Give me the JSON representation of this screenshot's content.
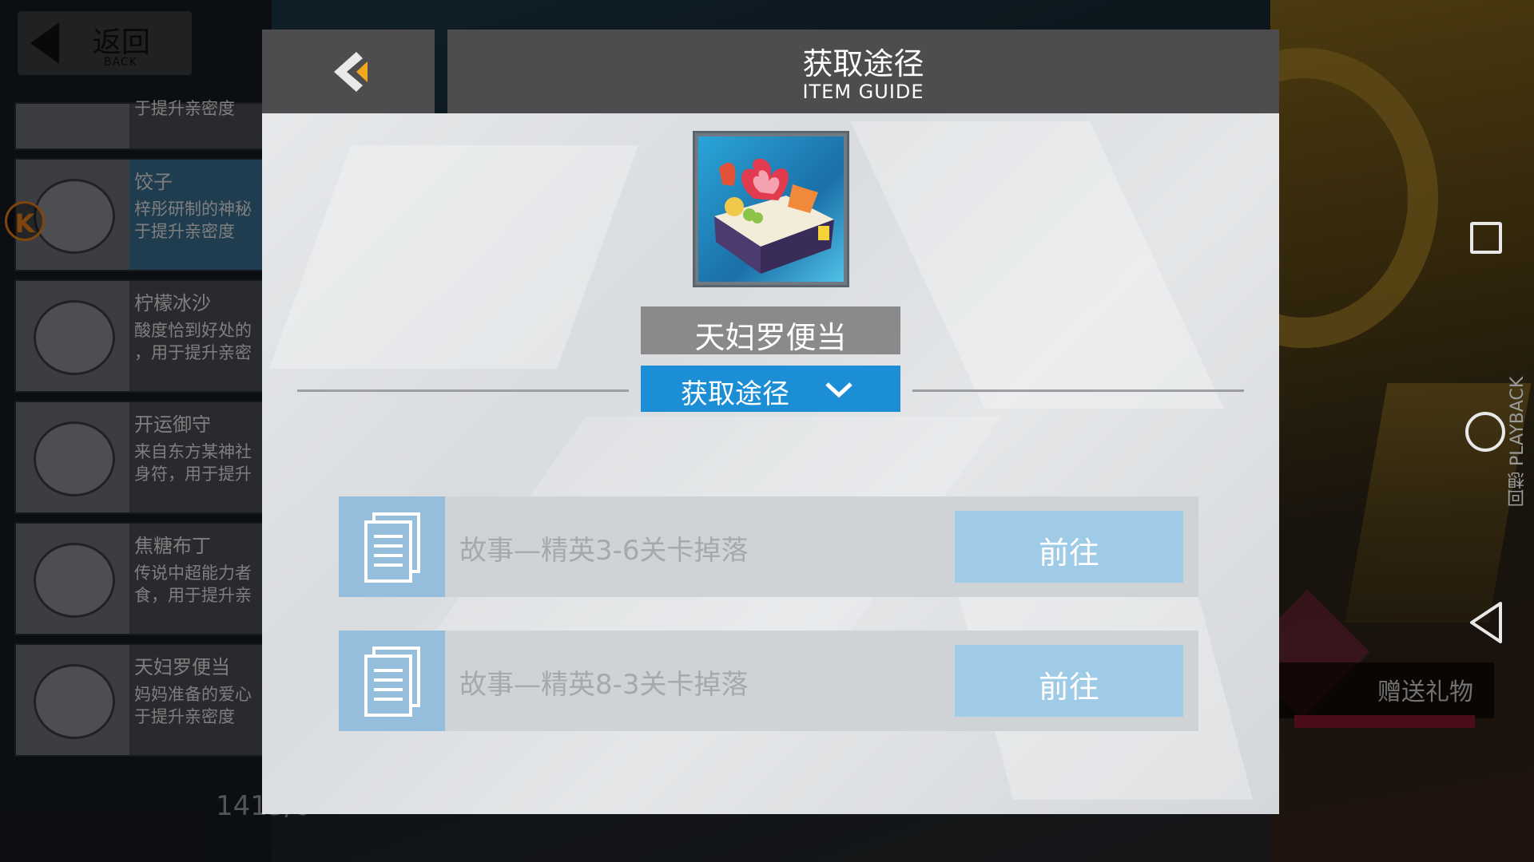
{
  "screen": {
    "accent": "#1c8ed6",
    "header_bg": "#4d4d4f"
  },
  "top_back": {
    "label": "返回",
    "sub": "BACK"
  },
  "item_list": [
    {
      "name": "",
      "desc": "于提升亲密度",
      "partial": true
    },
    {
      "name": "饺子",
      "desc": "梓彤研制的神秘\n于提升亲密度",
      "active": true
    },
    {
      "name": "柠檬冰沙",
      "desc": "酸度恰到好处的\n，用于提升亲密"
    },
    {
      "name": "开运御守",
      "desc": "来自东方某神社\n身符，用于提升"
    },
    {
      "name": "焦糖布丁",
      "desc": "传说中超能力者\n食，用于提升亲"
    },
    {
      "name": "天妇罗便当",
      "desc": "妈妈准备的爱心\n于提升亲密度"
    }
  ],
  "k_badge": "K",
  "dialog": {
    "title": "获取途径",
    "subtitle": "ITEM GUIDE",
    "item_name": "天妇罗便当",
    "item_icon": "bento-box-icon",
    "guide_button": "获取途径",
    "routes": [
      {
        "text": "故事—精英3-6关卡掉落",
        "go": "前往"
      },
      {
        "text": "故事—精英8-3关卡掉落",
        "go": "前往"
      }
    ]
  },
  "side": {
    "playback": "回想 PLAYBACK",
    "gift": "赠送礼物",
    "bottom_stat": "1415/0"
  }
}
